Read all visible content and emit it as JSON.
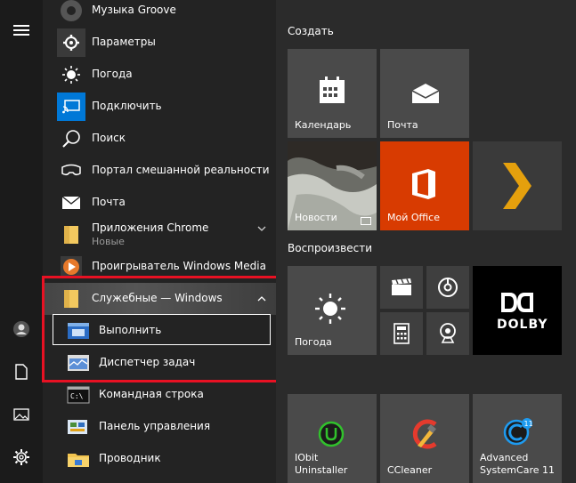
{
  "applist": {
    "items": [
      {
        "label": "Музыка Groove",
        "icon": "music-icon"
      },
      {
        "label": "Параметры",
        "icon": "gear-icon"
      },
      {
        "label": "Погода",
        "icon": "sun-icon"
      },
      {
        "label": "Подключить",
        "icon": "connect-icon"
      },
      {
        "label": "Поиск",
        "icon": "search-icon"
      },
      {
        "label": "Портал смешанной реальности",
        "icon": "headset-icon"
      },
      {
        "label": "Почта",
        "icon": "mail-icon"
      },
      {
        "label": "Приложения Chrome",
        "sub": "Новые",
        "icon": "folder-icon"
      },
      {
        "label": "Проигрыватель Windows Media",
        "icon": "media-player-icon"
      },
      {
        "label": "Служебные — Windows",
        "icon": "folder-icon"
      },
      {
        "label": "Выполнить",
        "icon": "run-icon"
      },
      {
        "label": "Диспетчер задач",
        "icon": "task-manager-icon"
      },
      {
        "label": "Командная строка",
        "icon": "cmd-icon"
      },
      {
        "label": "Панель управления",
        "icon": "control-panel-icon"
      },
      {
        "label": "Проводник",
        "icon": "explorer-icon"
      }
    ]
  },
  "tiles": {
    "group_create": "Создать",
    "group_play": "Воспроизвести",
    "calendar": "Календарь",
    "mail": "Почта",
    "news": "Новости",
    "office": "Мой Office",
    "weather": "Погода",
    "iobit": "IObit Uninstaller",
    "ccleaner": "CCleaner",
    "asc": "Advanced SystemCare 11",
    "dolby": "DOLBY"
  },
  "colors": {
    "accent": "#0078d7",
    "office": "#d83b01",
    "highlight": "#e81123"
  }
}
